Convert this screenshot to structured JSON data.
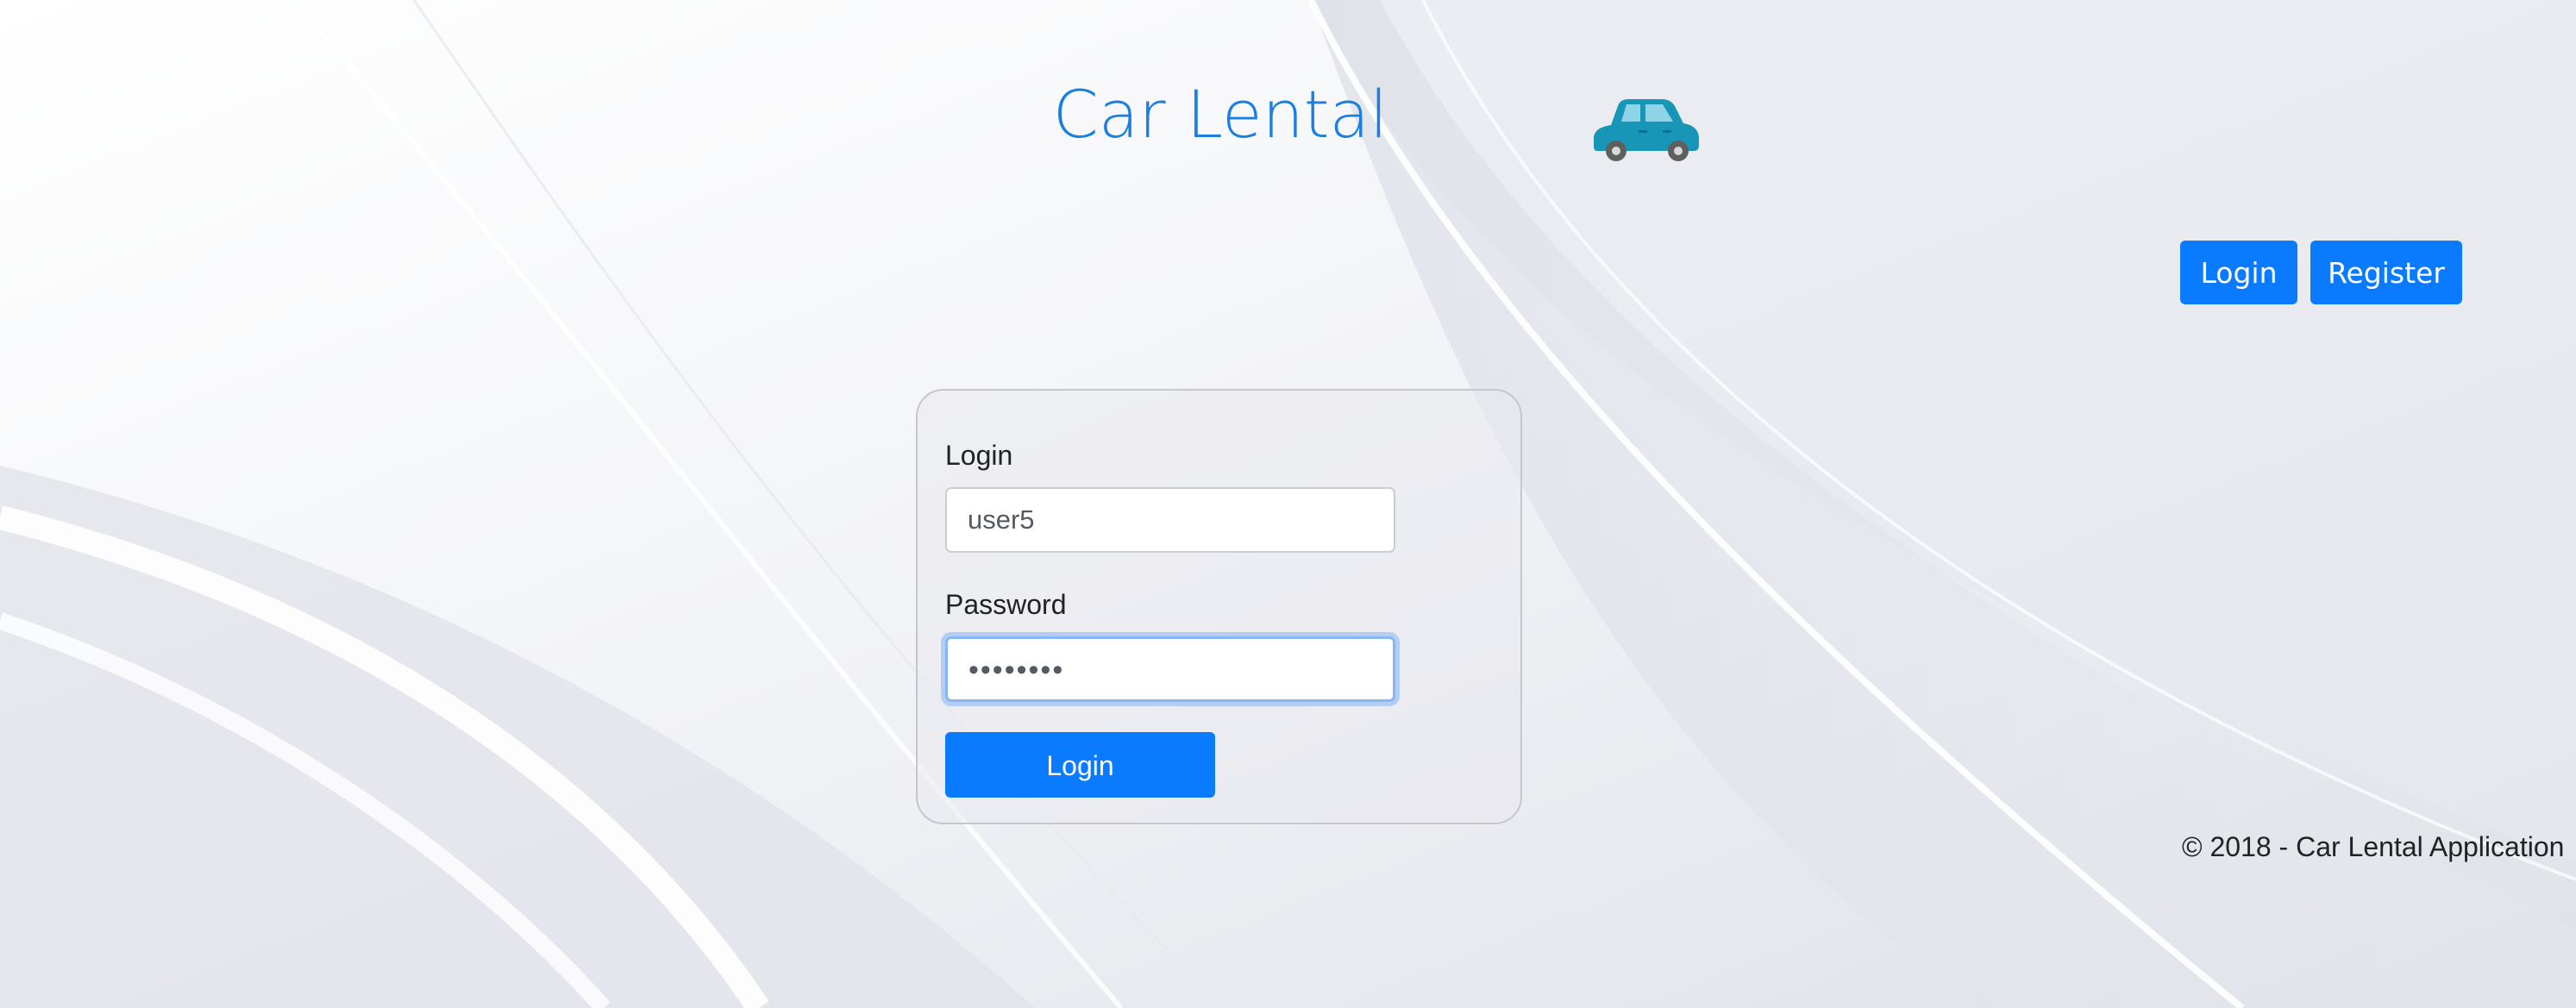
{
  "header": {
    "title": "Car Lental",
    "logo_icon": "car-icon",
    "nav": {
      "login_label": "Login",
      "register_label": "Register"
    }
  },
  "login_form": {
    "login_label": "Login",
    "login_value": "user5",
    "password_label": "Password",
    "password_value": "••••••••",
    "submit_label": "Login"
  },
  "footer": {
    "text": "© 2018 - Car Lental Application"
  },
  "colors": {
    "accent": "#0a7bff",
    "title": "#1a7fe0",
    "car_body": "#1796b8"
  }
}
